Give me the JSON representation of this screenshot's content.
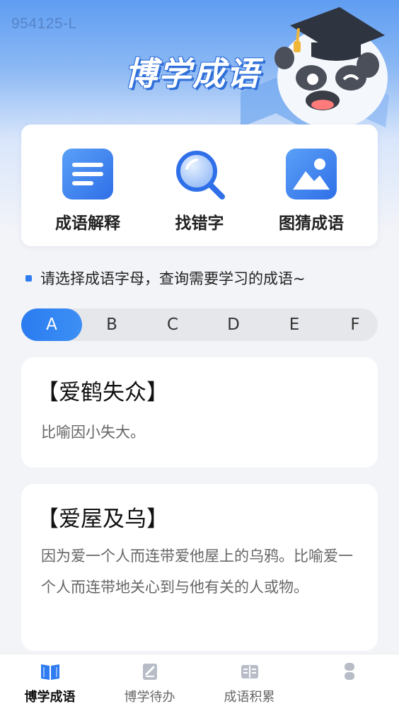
{
  "watermark": "954125-L",
  "app_title": "博学成语",
  "menu": [
    {
      "label": "成语解释",
      "icon": "document-lines-icon"
    },
    {
      "label": "找错字",
      "icon": "magnifier-icon"
    },
    {
      "label": "图猜成语",
      "icon": "picture-icon"
    }
  ],
  "hint": "请选择成语字母，查询需要学习的成语~",
  "letters": [
    "A",
    "B",
    "C",
    "D",
    "E",
    "F"
  ],
  "selected_letter": "A",
  "idioms": [
    {
      "title": "【爱鹤失众】",
      "desc": "比喻因小失大。"
    },
    {
      "title": "【爱屋及乌】",
      "desc": "因为爱一个人而连带爱他屋上的乌鸦。比喻爱一个人而连带地关心到与他有关的人或物。"
    }
  ],
  "tabs": [
    {
      "label": "博学成语",
      "icon": "book-icon",
      "active": true
    },
    {
      "label": "博学待办",
      "icon": "todo-note-icon",
      "active": false
    },
    {
      "label": "成语积累",
      "icon": "notebook-icon",
      "active": false
    },
    {
      "label": "",
      "icon": "profile-icon",
      "active": false
    }
  ],
  "colors": {
    "accent": "#2f7cf0",
    "hero_top": "#5f9df2",
    "background": "#f3f4f8"
  }
}
